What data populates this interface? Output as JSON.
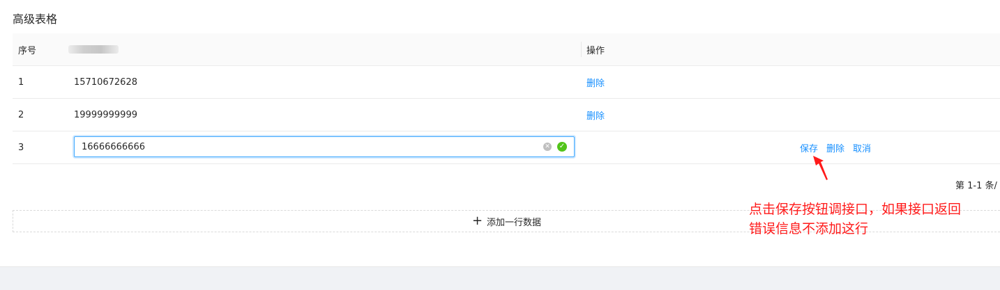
{
  "title": "高级表格",
  "table": {
    "columns": {
      "index": "序号",
      "operations": "操作"
    },
    "rows": [
      {
        "index": "1",
        "value": "15710672628",
        "delete": "删除"
      },
      {
        "index": "2",
        "value": "19999999999",
        "delete": "删除"
      }
    ],
    "editing_row": {
      "index": "3",
      "input_value": "16666666666",
      "save": "保存",
      "delete": "删除",
      "cancel": "取消"
    }
  },
  "pagination": {
    "text": "第 1-1 条/"
  },
  "add_row": {
    "label": "添加一行数据"
  },
  "annotation": {
    "line1": "点击保存按钮调接口，如果接口返回",
    "line2": "错误信息不添加这行",
    "color": "#ff1a1a"
  },
  "colors": {
    "link": "#1890ff",
    "success": "#52c41a",
    "focus_border": "#40a9ff"
  }
}
